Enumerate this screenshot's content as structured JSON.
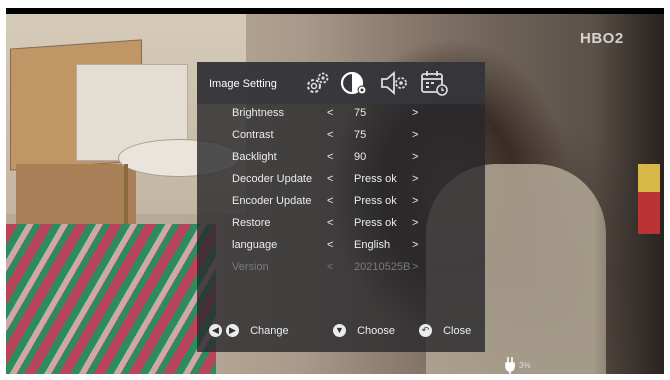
{
  "channel_logo": "HBO2",
  "menu": {
    "title": "Image Setting",
    "tabs": [
      {
        "name": "gears-icon"
      },
      {
        "name": "picture-settings-icon"
      },
      {
        "name": "audio-settings-icon"
      },
      {
        "name": "calendar-settings-icon"
      }
    ],
    "rows": [
      {
        "label": "Brightness",
        "value": "75",
        "left": "<",
        "right": ">"
      },
      {
        "label": "Contrast",
        "value": "75",
        "left": "<",
        "right": ">"
      },
      {
        "label": "Backlight",
        "value": "90",
        "left": "<",
        "right": ">"
      },
      {
        "label": "Decoder Update",
        "value": "Press ok",
        "left": "<",
        "right": ">"
      },
      {
        "label": "Encoder Update",
        "value": "Press ok",
        "left": "<",
        "right": ">"
      },
      {
        "label": "Restore",
        "value": "Press ok",
        "left": "<",
        "right": ">"
      },
      {
        "label": "language",
        "value": "English",
        "left": "<",
        "right": ">"
      },
      {
        "label": "Version",
        "value": "20210525B",
        "left": "<",
        "right": ">"
      }
    ],
    "footer": {
      "change": "Change",
      "choose": "Choose",
      "close": "Close"
    }
  },
  "colors": {
    "menu_bg": "#2b2b30",
    "text": "#ececec",
    "dim_text": "#7a7a7a"
  }
}
